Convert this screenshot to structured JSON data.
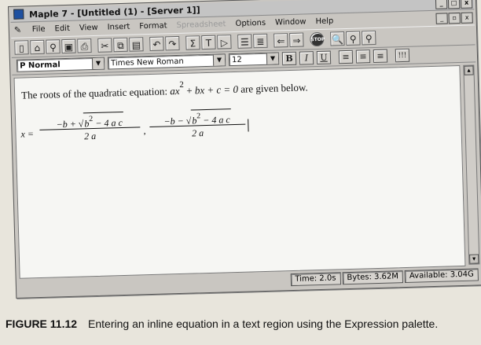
{
  "window": {
    "title": "Maple 7 - [Untitled (1) - [Server 1]]",
    "title_ctrls": [
      "_",
      "□",
      "x"
    ],
    "doc_ctrls": [
      "_",
      "▫",
      "x"
    ]
  },
  "menu": {
    "items": [
      "File",
      "Edit",
      "View",
      "Insert",
      "Format",
      "Spreadsheet",
      "Options",
      "Window",
      "Help"
    ],
    "disabled": [
      "Spreadsheet"
    ]
  },
  "toolbar": {
    "buttons": [
      "new-icon",
      "open-icon",
      "open-url-icon",
      "save-icon",
      "print-icon",
      "cut-icon",
      "copy-icon",
      "paste-icon",
      "undo-icon",
      "redo-icon",
      "sigma-icon",
      "text-icon",
      "prompt-icon",
      "collapse-icon",
      "expand-icon",
      "back-icon",
      "forward-icon",
      "stop-icon",
      "zoom-in-icon",
      "zoom-mid-icon",
      "zoom-out-icon"
    ]
  },
  "format": {
    "style": "P Normal",
    "font": "Times New Roman",
    "size": "12",
    "bold": "B",
    "italic": "I",
    "underline": "U",
    "exclaim": "!!!"
  },
  "document": {
    "text_before": "The roots of the quadratic equation: ",
    "a": "a",
    "x": "x",
    "sup": "2",
    "text_mid": " + ",
    "b": "b",
    "plus_c": " + c = 0",
    "text_after": " are given below.",
    "eq_lhs": "x =",
    "root1_prefix": "−b + √",
    "root2_prefix": "−b − √",
    "radicand": "b",
    "radicand_rest": " − 4 a c",
    "denominator": "2 a",
    "separator": ","
  },
  "status": {
    "time": "Time: 2.0s",
    "bytes": "Bytes: 3.62M",
    "available": "Available: 3.04G"
  },
  "caption": {
    "figure": "FIGURE 11.12",
    "text": "Entering an inline equation in a text region using the Expression palette."
  }
}
